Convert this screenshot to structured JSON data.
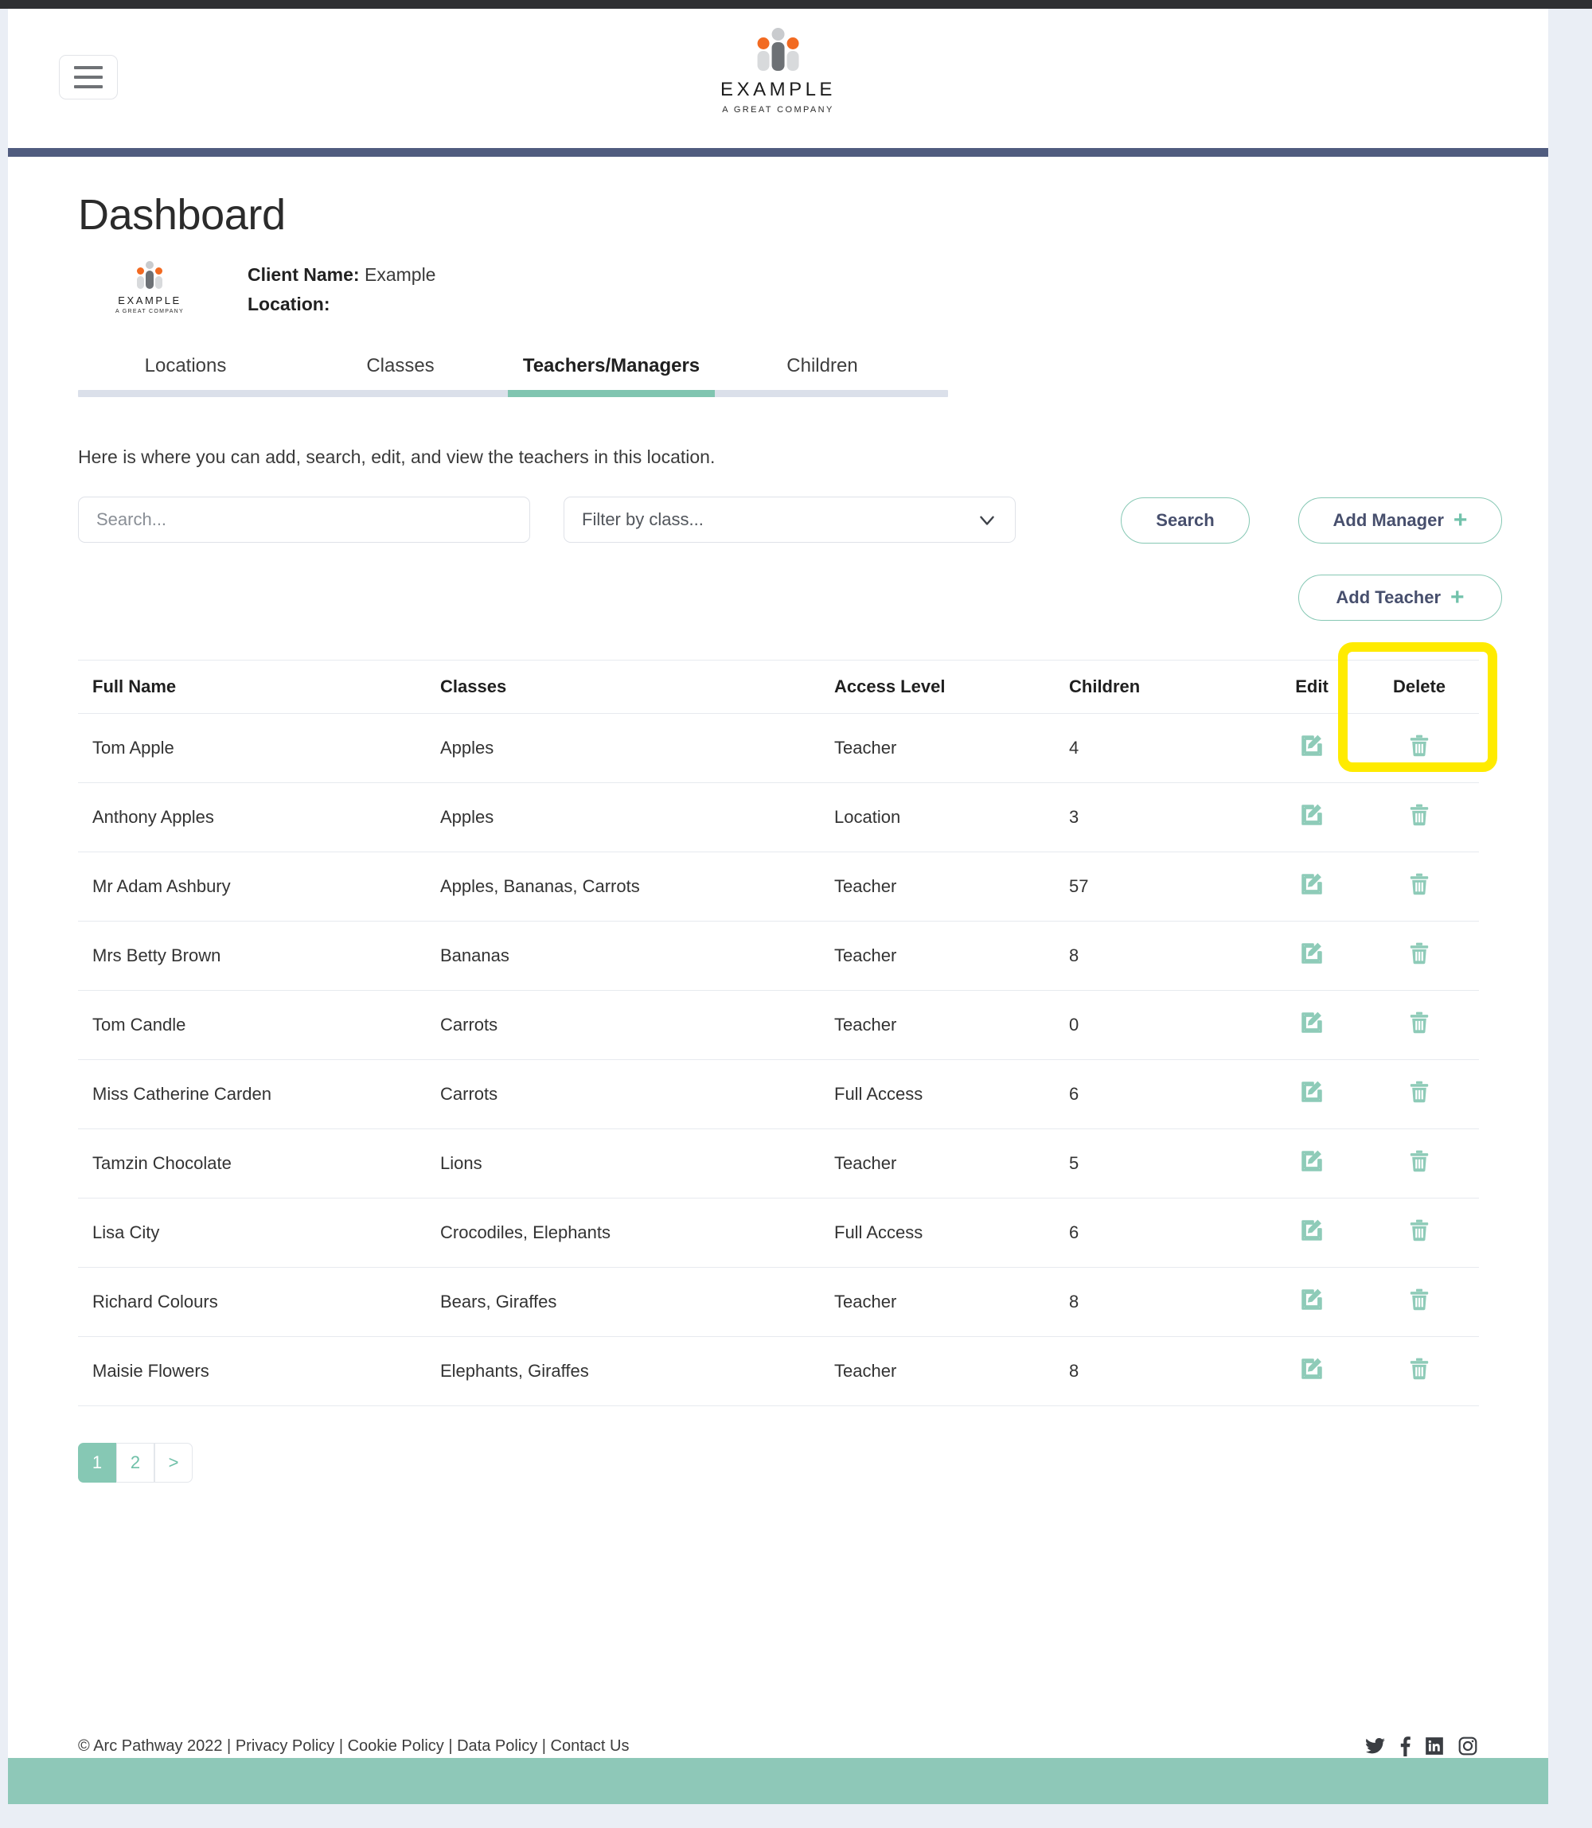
{
  "header": {
    "menu_icon": "hamburger-icon",
    "brand_name": "EXAMPLE",
    "brand_tagline": "A GREAT COMPANY"
  },
  "page": {
    "title": "Dashboard",
    "client_name_label": "Client Name:",
    "client_name_value": "Example",
    "location_label": "Location:",
    "location_value": ""
  },
  "tabs": [
    {
      "label": "Locations",
      "active": false
    },
    {
      "label": "Classes",
      "active": false
    },
    {
      "label": "Teachers/Managers",
      "active": true
    },
    {
      "label": "Children",
      "active": false
    }
  ],
  "helper_text": "Here is where you can add, search, edit, and view the teachers in this location.",
  "controls": {
    "search_placeholder": "Search...",
    "search_value": "",
    "filter_label": "Filter by class...",
    "search_button": "Search",
    "add_manager_button": "Add Manager",
    "add_teacher_button": "Add Teacher",
    "plus_glyph": "+"
  },
  "table": {
    "columns": [
      "Full Name",
      "Classes",
      "Access Level",
      "Children",
      "Edit",
      "Delete"
    ],
    "rows": [
      {
        "name": "Tom Apple",
        "classes": "Apples",
        "access": "Teacher",
        "children": "4"
      },
      {
        "name": "Anthony Apples",
        "classes": "Apples",
        "access": "Location",
        "children": "3"
      },
      {
        "name": "Mr Adam Ashbury",
        "classes": "Apples, Bananas, Carrots",
        "access": "Teacher",
        "children": "57"
      },
      {
        "name": "Mrs Betty Brown",
        "classes": "Bananas",
        "access": "Teacher",
        "children": "8"
      },
      {
        "name": "Tom Candle",
        "classes": "Carrots",
        "access": "Teacher",
        "children": "0"
      },
      {
        "name": "Miss Catherine Carden",
        "classes": "Carrots",
        "access": "Full Access",
        "children": "6"
      },
      {
        "name": "Tamzin Chocolate",
        "classes": "Lions",
        "access": "Teacher",
        "children": "5"
      },
      {
        "name": "Lisa City",
        "classes": "Crocodiles, Elephants",
        "access": "Full Access",
        "children": "6"
      },
      {
        "name": "Richard Colours",
        "classes": "Bears, Giraffes",
        "access": "Teacher",
        "children": "8"
      },
      {
        "name": "Maisie Flowers",
        "classes": "Elephants, Giraffes",
        "access": "Teacher",
        "children": "8"
      }
    ]
  },
  "pagination": [
    {
      "label": "1",
      "active": true
    },
    {
      "label": "2",
      "active": false
    },
    {
      "label": ">",
      "active": false
    }
  ],
  "footer": {
    "text": "© Arc Pathway 2022 | Privacy Policy | Cookie Policy | Data Policy | Contact Us",
    "social": [
      "twitter-icon",
      "facebook-icon",
      "linkedin-icon",
      "instagram-icon"
    ]
  },
  "colors": {
    "accent_green": "#86c8b4",
    "navy_rule": "#505c7f",
    "highlight_yellow": "#ffeb00",
    "logo_orange": "#f26a21",
    "page_background": "#eaeef5"
  }
}
